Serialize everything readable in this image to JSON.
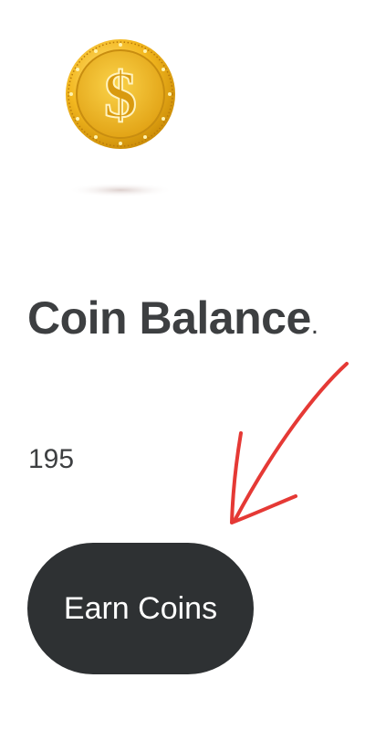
{
  "header": {
    "coin_icon": "dollar-coin-icon",
    "title": "Coin Balance",
    "title_suffix": "."
  },
  "balance": {
    "value": "195"
  },
  "actions": {
    "earn_label": "Earn Coins"
  },
  "colors": {
    "text": "#3d3f41",
    "button_bg": "#2e3133",
    "button_text": "#ffffff",
    "coin_gold": "#f2b51c",
    "annotation_red": "#e53935"
  }
}
